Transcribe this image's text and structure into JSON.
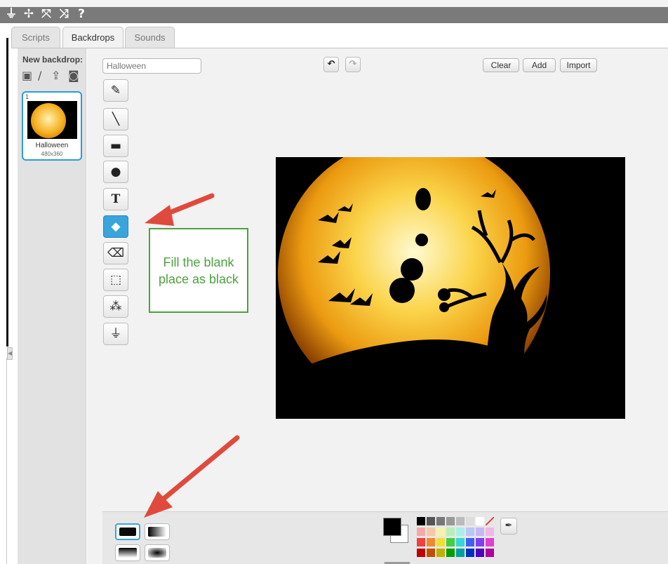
{
  "top_toolbar": {
    "icons": [
      "stamp-icon",
      "grow-icon",
      "expand-icon",
      "shrink-icon",
      "help-icon"
    ]
  },
  "tabs": [
    {
      "label": "Scripts",
      "active": false
    },
    {
      "label": "Backdrops",
      "active": true
    },
    {
      "label": "Sounds",
      "active": false
    }
  ],
  "sidebar": {
    "new_backdrop_label": "New backdrop:",
    "new_backdrop_icons": [
      "library-icon",
      "paint-icon",
      "upload-icon",
      "camera-icon"
    ],
    "backdrops": [
      {
        "index": "1",
        "name": "Halloween",
        "size": "480x360",
        "selected": true
      }
    ]
  },
  "editor": {
    "costume_name_value": "Halloween",
    "undo_icon": "undo-icon",
    "redo_icon": "redo-icon",
    "clear_label": "Clear",
    "add_label": "Add",
    "import_label": "Import",
    "tools": [
      {
        "name": "brush-tool",
        "icon": "brush-icon",
        "glyph": "✎"
      },
      {
        "name": "line-tool",
        "icon": "line-icon",
        "glyph": "╲"
      },
      {
        "name": "rectangle-tool",
        "icon": "rectangle-icon",
        "glyph": "▬"
      },
      {
        "name": "ellipse-tool",
        "icon": "ellipse-icon",
        "glyph": "●"
      },
      {
        "name": "text-tool",
        "icon": "text-icon",
        "glyph": "T"
      },
      {
        "name": "fill-tool",
        "icon": "paint-bucket-icon",
        "glyph": "◆",
        "active": true
      },
      {
        "name": "eraser-tool",
        "icon": "eraser-icon",
        "glyph": "⌫"
      },
      {
        "name": "select-tool",
        "icon": "select-icon",
        "glyph": "⬚"
      },
      {
        "name": "select-erase-tool",
        "icon": "magic-select-icon",
        "glyph": "⁂"
      },
      {
        "name": "stamp-tool",
        "icon": "stamp-icon",
        "glyph": "⏚"
      }
    ]
  },
  "annotation": {
    "text": "Fill the blank place as black",
    "color": "#4ca23e",
    "arrow_color": "#e04a3c"
  },
  "color_panel": {
    "primary_color": "#000000",
    "secondary_color": "#ffffff",
    "fill_modes": [
      "solid-fill",
      "horizontal-gradient",
      "vertical-gradient",
      "radial-gradient"
    ],
    "picker_icon": "eyedropper-icon",
    "palette_rows": [
      [
        "#000000",
        "#555555",
        "#777777",
        "#999999",
        "#bbbbbb",
        "#dddddd",
        "#ffffff",
        "transparent"
      ],
      [
        "#f7a7a7",
        "#f7c7a7",
        "#f7f3a7",
        "#b7f0b7",
        "#a7f0e7",
        "#b7c7f7",
        "#c7b7f7",
        "#f0b7e7"
      ],
      [
        "#f04040",
        "#f08a30",
        "#f0e030",
        "#40d040",
        "#30d8d8",
        "#4060f0",
        "#8040f0",
        "#e040d0"
      ],
      [
        "#c00000",
        "#c05000",
        "#c0b000",
        "#00a000",
        "#00a0a0",
        "#0030c0",
        "#5000c0",
        "#b000a0"
      ]
    ]
  }
}
